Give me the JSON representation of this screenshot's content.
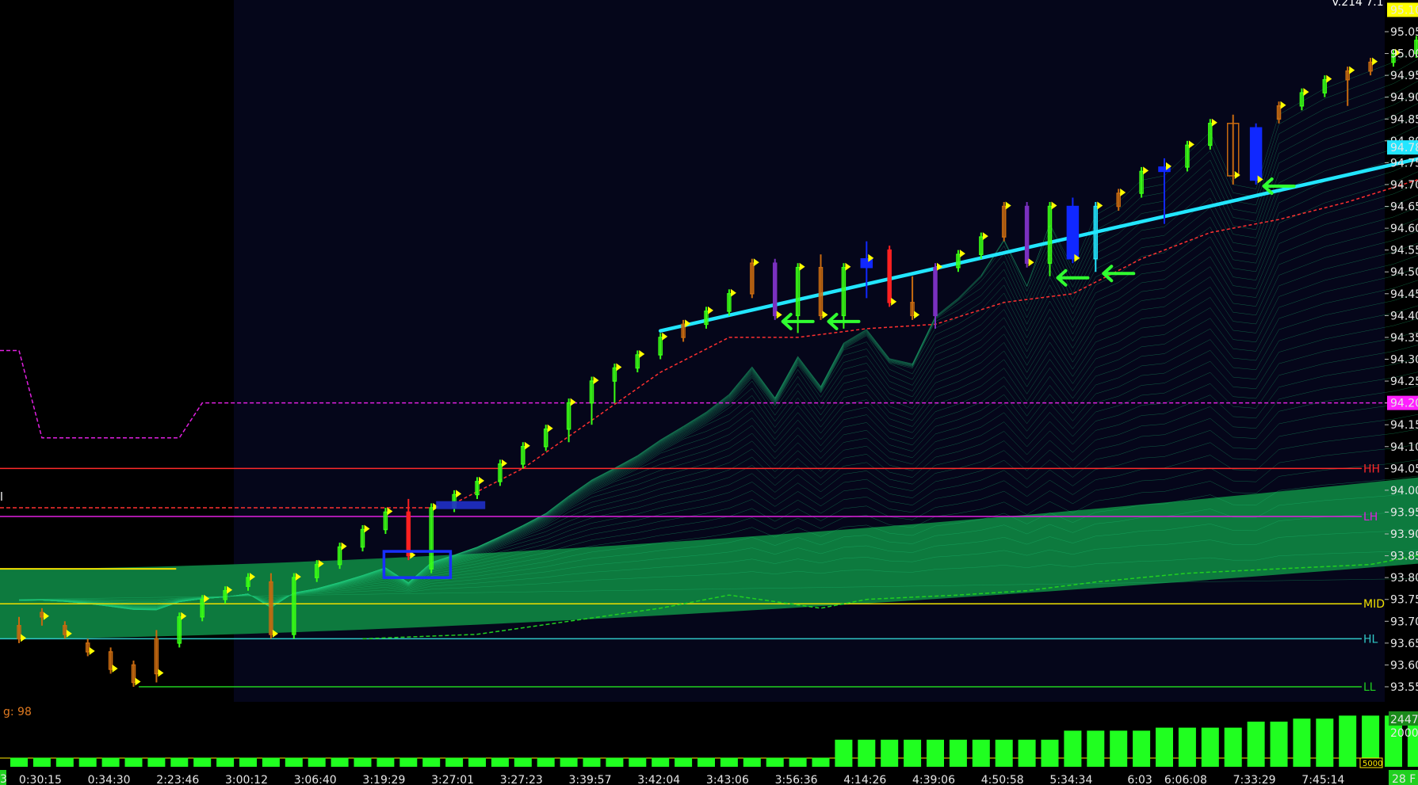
{
  "colors": {
    "background": "#000000",
    "session_bg": "#05061a",
    "ribbon": "#0d7a3e",
    "ribbon_line": "#1ec77a",
    "up_bar": "#39ff14",
    "down_bar": "#c86a10",
    "strong_up": "#7a30c0",
    "strong_down": "#ff2020",
    "blue_bar": "#1028ff",
    "trend": "#22e6ff",
    "dashed_red": "#ff3030",
    "magenta": "#e020e0",
    "yellow": "#f0e000",
    "cyan_line": "#30c8c8",
    "green_line": "#20d020",
    "arrow": "#30ff30",
    "marker": "#ffff00",
    "volume": "#20ff20",
    "price_box_yellow": "#ffff00",
    "price_box_cyan": "#22e6ff",
    "price_box_magenta": "#ff20ff"
  },
  "chart_data": {
    "type": "candlestick",
    "ylim": [
      93.51,
      95.13
    ],
    "y_ticks": [
      "95.05",
      "95.00",
      "94.95",
      "94.90",
      "94.85",
      "94.80",
      "94.75",
      "94.70",
      "94.65",
      "94.60",
      "94.55",
      "94.50",
      "94.45",
      "94.40",
      "94.35",
      "94.30",
      "94.25",
      "94.20",
      "94.15",
      "94.10",
      "94.05",
      "94.00",
      "93.95",
      "93.90",
      "93.85",
      "93.80",
      "93.75",
      "93.70",
      "93.65",
      "93.60",
      "93.55"
    ],
    "y_tick_values": [
      95.05,
      95.0,
      94.95,
      94.9,
      94.85,
      94.8,
      94.75,
      94.7,
      94.65,
      94.6,
      94.55,
      94.5,
      94.45,
      94.4,
      94.35,
      94.3,
      94.25,
      94.2,
      94.15,
      94.1,
      94.05,
      94.0,
      93.95,
      93.9,
      93.85,
      93.8,
      93.75,
      93.7,
      93.65,
      93.6,
      93.55
    ],
    "x_labels": [
      "0:30:15",
      "0:34:30",
      "2:23:46",
      "3:00:12",
      "3:06:40",
      "3:19:29",
      "3:27:01",
      "3:27:23",
      "3:39:57",
      "3:42:04",
      "3:43:06",
      "3:56:36",
      "4:14:26",
      "4:39:06",
      "4:50:58",
      "5:34:34",
      "6:03",
      "6:06:08",
      "7:33:29",
      "7:45:14"
    ],
    "x_label_index": [
      1,
      4,
      7,
      10,
      13,
      16,
      19,
      22,
      25,
      28,
      31,
      34,
      37,
      40,
      43,
      46,
      49,
      51,
      54,
      57
    ],
    "bars": [
      {
        "o": 93.69,
        "h": 93.71,
        "l": 93.65,
        "c": 93.66,
        "t": "d"
      },
      {
        "o": 93.72,
        "h": 93.73,
        "l": 93.69,
        "c": 93.71,
        "t": "d"
      },
      {
        "o": 93.69,
        "h": 93.7,
        "l": 93.66,
        "c": 93.67,
        "t": "d"
      },
      {
        "o": 93.65,
        "h": 93.66,
        "l": 93.62,
        "c": 93.63,
        "t": "d"
      },
      {
        "o": 93.63,
        "h": 93.64,
        "l": 93.58,
        "c": 93.59,
        "t": "d"
      },
      {
        "o": 93.6,
        "h": 93.61,
        "l": 93.55,
        "c": 93.56,
        "t": "d"
      },
      {
        "o": 93.66,
        "h": 93.68,
        "l": 93.56,
        "c": 93.58,
        "t": "d"
      },
      {
        "o": 93.65,
        "h": 93.72,
        "l": 93.64,
        "c": 93.71,
        "t": "u"
      },
      {
        "o": 93.71,
        "h": 93.76,
        "l": 93.7,
        "c": 93.75,
        "t": "u"
      },
      {
        "o": 93.75,
        "h": 93.78,
        "l": 93.74,
        "c": 93.77,
        "t": "u"
      },
      {
        "o": 93.78,
        "h": 93.81,
        "l": 93.77,
        "c": 93.8,
        "t": "u"
      },
      {
        "o": 93.79,
        "h": 93.81,
        "l": 93.66,
        "c": 93.67,
        "t": "d"
      },
      {
        "o": 93.67,
        "h": 93.81,
        "l": 93.66,
        "c": 93.8,
        "t": "u"
      },
      {
        "o": 93.8,
        "h": 93.84,
        "l": 93.79,
        "c": 93.83,
        "t": "u"
      },
      {
        "o": 93.83,
        "h": 93.88,
        "l": 93.82,
        "c": 93.87,
        "t": "u"
      },
      {
        "o": 93.87,
        "h": 93.92,
        "l": 93.86,
        "c": 93.91,
        "t": "u"
      },
      {
        "o": 93.91,
        "h": 93.96,
        "l": 93.9,
        "c": 93.95,
        "t": "u"
      },
      {
        "o": 93.95,
        "h": 93.98,
        "l": 93.84,
        "c": 93.85,
        "t": "x"
      },
      {
        "o": 93.82,
        "h": 93.97,
        "l": 93.81,
        "c": 93.96,
        "t": "u"
      },
      {
        "o": 93.96,
        "h": 94.0,
        "l": 93.95,
        "c": 93.99,
        "t": "u"
      },
      {
        "o": 93.99,
        "h": 94.03,
        "l": 93.98,
        "c": 94.02,
        "t": "u"
      },
      {
        "o": 94.02,
        "h": 94.07,
        "l": 94.01,
        "c": 94.06,
        "t": "u"
      },
      {
        "o": 94.06,
        "h": 94.11,
        "l": 94.05,
        "c": 94.1,
        "t": "u"
      },
      {
        "o": 94.1,
        "h": 94.15,
        "l": 94.09,
        "c": 94.14,
        "t": "u"
      },
      {
        "o": 94.14,
        "h": 94.21,
        "l": 94.11,
        "c": 94.2,
        "t": "u"
      },
      {
        "o": 94.2,
        "h": 94.26,
        "l": 94.15,
        "c": 94.25,
        "t": "u"
      },
      {
        "o": 94.25,
        "h": 94.29,
        "l": 94.2,
        "c": 94.28,
        "t": "u"
      },
      {
        "o": 94.28,
        "h": 94.32,
        "l": 94.27,
        "c": 94.31,
        "t": "u"
      },
      {
        "o": 94.31,
        "h": 94.36,
        "l": 94.3,
        "c": 94.35,
        "t": "u"
      },
      {
        "o": 94.35,
        "h": 94.39,
        "l": 94.34,
        "c": 94.38,
        "t": "d"
      },
      {
        "o": 94.38,
        "h": 94.42,
        "l": 94.37,
        "c": 94.41,
        "t": "u"
      },
      {
        "o": 94.41,
        "h": 94.46,
        "l": 94.4,
        "c": 94.45,
        "t": "u"
      },
      {
        "o": 94.45,
        "h": 94.53,
        "l": 94.44,
        "c": 94.52,
        "t": "d"
      },
      {
        "o": 94.52,
        "h": 94.53,
        "l": 94.39,
        "c": 94.4,
        "t": "p"
      },
      {
        "o": 94.4,
        "h": 94.52,
        "l": 94.36,
        "c": 94.51,
        "t": "u"
      },
      {
        "o": 94.51,
        "h": 94.54,
        "l": 94.39,
        "c": 94.4,
        "t": "d"
      },
      {
        "o": 94.4,
        "h": 94.52,
        "l": 94.37,
        "c": 94.51,
        "t": "u"
      },
      {
        "o": 94.51,
        "h": 94.57,
        "l": 94.44,
        "c": 94.53,
        "t": "b"
      },
      {
        "o": 94.55,
        "h": 94.56,
        "l": 94.42,
        "c": 94.43,
        "t": "x"
      },
      {
        "o": 94.43,
        "h": 94.49,
        "l": 94.39,
        "c": 94.4,
        "t": "d"
      },
      {
        "o": 94.4,
        "h": 94.52,
        "l": 94.37,
        "c": 94.51,
        "t": "p"
      },
      {
        "o": 94.51,
        "h": 94.55,
        "l": 94.5,
        "c": 94.54,
        "t": "u"
      },
      {
        "o": 94.54,
        "h": 94.59,
        "l": 94.53,
        "c": 94.58,
        "t": "u"
      },
      {
        "o": 94.58,
        "h": 94.66,
        "l": 94.57,
        "c": 94.65,
        "t": "d"
      },
      {
        "o": 94.65,
        "h": 94.66,
        "l": 94.51,
        "c": 94.52,
        "t": "p"
      },
      {
        "o": 94.52,
        "h": 94.66,
        "l": 94.49,
        "c": 94.65,
        "t": "u"
      },
      {
        "o": 94.65,
        "h": 94.67,
        "l": 94.52,
        "c": 94.53,
        "t": "b"
      },
      {
        "o": 94.53,
        "h": 94.66,
        "l": 94.5,
        "c": 94.65,
        "t": "c"
      },
      {
        "o": 94.65,
        "h": 94.69,
        "l": 94.64,
        "c": 94.68,
        "t": "d"
      },
      {
        "o": 94.68,
        "h": 94.74,
        "l": 94.67,
        "c": 94.73,
        "t": "u"
      },
      {
        "o": 94.73,
        "h": 94.76,
        "l": 94.61,
        "c": 94.74,
        "t": "b"
      },
      {
        "o": 94.74,
        "h": 94.8,
        "l": 94.73,
        "c": 94.79,
        "t": "u"
      },
      {
        "o": 94.79,
        "h": 94.85,
        "l": 94.78,
        "c": 94.84,
        "t": "u"
      },
      {
        "o": 94.84,
        "h": 94.86,
        "l": 94.7,
        "c": 94.72,
        "t": "o"
      },
      {
        "o": 94.83,
        "h": 94.84,
        "l": 94.7,
        "c": 94.71,
        "t": "b"
      },
      {
        "o": 94.85,
        "h": 94.89,
        "l": 94.84,
        "c": 94.88,
        "t": "d"
      },
      {
        "o": 94.88,
        "h": 94.92,
        "l": 94.87,
        "c": 94.91,
        "t": "u"
      },
      {
        "o": 94.91,
        "h": 94.95,
        "l": 94.9,
        "c": 94.94,
        "t": "u"
      },
      {
        "o": 94.94,
        "h": 94.97,
        "l": 94.88,
        "c": 94.96,
        "t": "d"
      },
      {
        "o": 94.96,
        "h": 94.99,
        "l": 94.95,
        "c": 94.98,
        "t": "d"
      },
      {
        "o": 94.98,
        "h": 95.01,
        "l": 94.97,
        "c": 95.0,
        "t": "u"
      },
      {
        "o": 95.0,
        "h": 95.04,
        "l": 94.99,
        "c": 95.03,
        "t": "u"
      },
      {
        "o": 95.03,
        "h": 95.07,
        "l": 95.02,
        "c": 95.06,
        "t": "u"
      },
      {
        "o": 95.06,
        "h": 95.12,
        "l": 95.05,
        "c": 95.1,
        "t": "d"
      }
    ],
    "levels": [
      {
        "name": "HH",
        "value": 94.05,
        "color": "#ff2a2a",
        "style": "solid"
      },
      {
        "name": "LH",
        "value": 93.94,
        "color": "#e020e0",
        "style": "solid"
      },
      {
        "name": "MID",
        "value": 93.74,
        "color": "#f0e000",
        "style": "solid"
      },
      {
        "name": "HL",
        "value": 93.66,
        "color": "#30c8c8",
        "style": "solid"
      },
      {
        "name": "LL",
        "value": 93.55,
        "color": "#20d020",
        "style": "solid"
      }
    ],
    "price_boxes": [
      {
        "label": "95.10",
        "value": 95.1,
        "color": "#ffff00",
        "text": "#000000"
      },
      {
        "label": "94.78",
        "value": 94.785,
        "color": "#22e6ff",
        "text": "#000000"
      },
      {
        "label": "94.20",
        "value": 94.2,
        "color": "#ff20ff",
        "text": "#000000"
      }
    ],
    "trend_line": {
      "from": [
        28,
        94.365
      ],
      "to": [
        63,
        94.785
      ]
    },
    "dashed_red": [
      [
        19,
        93.97
      ],
      [
        22,
        94.05
      ],
      [
        25,
        94.16
      ],
      [
        28,
        94.27
      ],
      [
        31,
        94.35
      ],
      [
        34,
        94.35
      ],
      [
        37,
        94.37
      ],
      [
        40,
        94.38
      ],
      [
        43,
        94.43
      ],
      [
        46,
        94.45
      ],
      [
        49,
        94.53
      ],
      [
        52,
        94.59
      ],
      [
        55,
        94.62
      ],
      [
        58,
        94.66
      ],
      [
        61,
        94.71
      ],
      [
        63,
        94.77
      ]
    ],
    "dashed_magenta": [
      [
        -1,
        94.32
      ],
      [
        0,
        94.32
      ],
      [
        1,
        94.12
      ],
      [
        7,
        94.12
      ],
      [
        8,
        94.2
      ],
      [
        63,
        94.2
      ]
    ],
    "dashed_green": [
      [
        15,
        93.66
      ],
      [
        20,
        93.67
      ],
      [
        24,
        93.7
      ],
      [
        28,
        93.73
      ],
      [
        31,
        93.76
      ],
      [
        35,
        93.73
      ],
      [
        37,
        93.75
      ],
      [
        41,
        93.76
      ],
      [
        44,
        93.77
      ],
      [
        47,
        93.79
      ],
      [
        51,
        93.81
      ],
      [
        55,
        93.82
      ],
      [
        59,
        93.83
      ],
      [
        62,
        93.86
      ]
    ],
    "dashed_red_short": {
      "from": [
        -1,
        93.96
      ],
      "to": [
        18,
        93.96
      ]
    },
    "yellow_short": {
      "from": [
        -1,
        93.82
      ],
      "to": [
        7,
        93.82
      ]
    },
    "arrow_bars": [
      33,
      35,
      45,
      47,
      54
    ],
    "volume": [
      0.3,
      0.3,
      0.3,
      0.3,
      0.3,
      0.3,
      0.3,
      0.3,
      0.3,
      0.3,
      0.3,
      0.3,
      0.3,
      0.3,
      0.3,
      0.3,
      0.3,
      0.3,
      0.3,
      0.3,
      0.3,
      0.3,
      0.3,
      0.3,
      0.3,
      0.3,
      0.3,
      0.3,
      0.3,
      0.3,
      0.3,
      0.3,
      0.3,
      0.3,
      0.3,
      0.3,
      0.9,
      0.9,
      0.9,
      0.9,
      0.9,
      0.9,
      0.9,
      0.9,
      0.9,
      0.9,
      1.2,
      1.2,
      1.2,
      1.2,
      1.3,
      1.3,
      1.3,
      1.3,
      1.5,
      1.5,
      1.6,
      1.6,
      1.7,
      1.7,
      1.7,
      1.7,
      1.7,
      1.8
    ],
    "volume_labels": {
      "top": "2447",
      "mid": "2000",
      "bottom": "5000"
    },
    "indicator_label": "g: 98",
    "corner_label_left": "3",
    "corner_label_right": "28 F",
    "top_right_label": "V.214 7.1",
    "left_cut_label": "l"
  }
}
